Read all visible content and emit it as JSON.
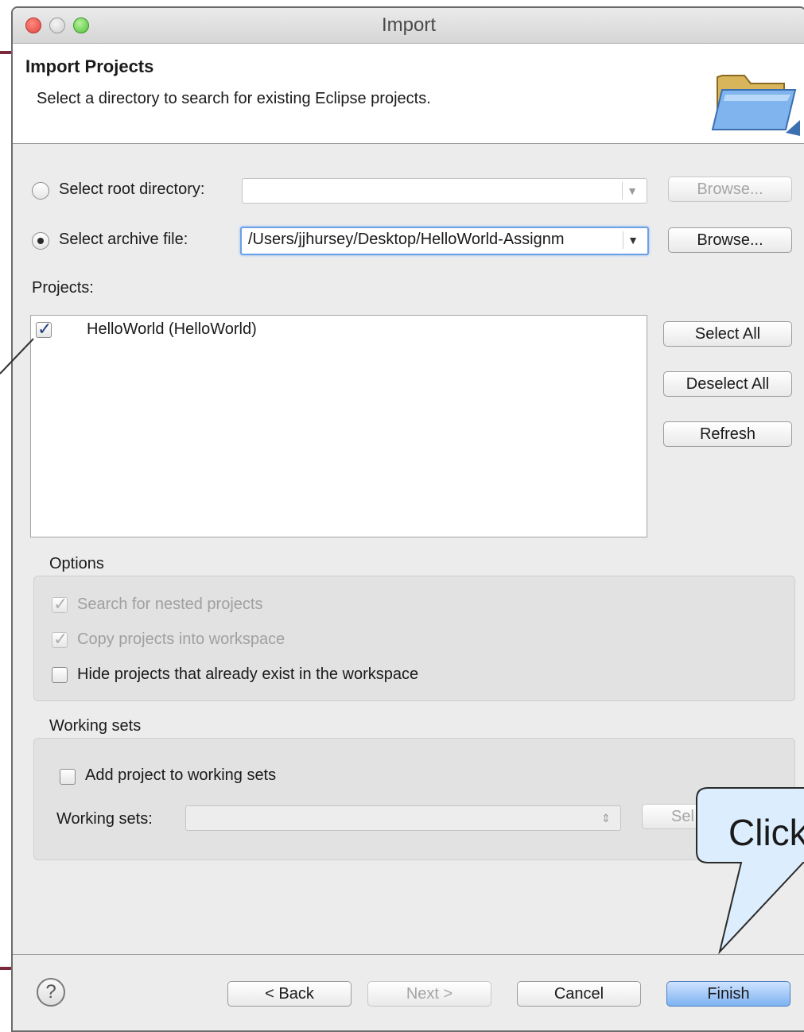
{
  "window": {
    "title": "Import"
  },
  "header": {
    "title": "Import Projects",
    "description": "Select a directory to search for existing Eclipse projects."
  },
  "source": {
    "root_directory_label": "Select root directory:",
    "root_directory_value": "",
    "root_browse_label": "Browse...",
    "archive_file_label": "Select archive file:",
    "archive_file_value": "/Users/jjhursey/Desktop/HelloWorld-Assignm",
    "archive_browse_label": "Browse...",
    "selected": "archive"
  },
  "projects": {
    "label": "Projects:",
    "items": [
      {
        "label": "HelloWorld (HelloWorld)",
        "checked": true
      }
    ],
    "select_all_label": "Select All",
    "deselect_all_label": "Deselect All",
    "refresh_label": "Refresh"
  },
  "options": {
    "title": "Options",
    "search_nested_label": "Search for nested projects",
    "copy_into_workspace_label": "Copy projects into workspace",
    "hide_existing_label": "Hide projects that already exist in the workspace"
  },
  "working_sets": {
    "title": "Working sets",
    "add_label": "Add project to working sets",
    "sets_label": "Working sets:",
    "select_button_label": "Sel"
  },
  "footer": {
    "help_glyph": "?",
    "back_label": "< Back",
    "next_label": "Next >",
    "cancel_label": "Cancel",
    "finish_label": "Finish"
  },
  "annotation": {
    "callout_text": "Click"
  },
  "colors": {
    "accent": "#7a2a3a",
    "default_button": "#7db2f1",
    "callout_fill": "#dceefe"
  }
}
